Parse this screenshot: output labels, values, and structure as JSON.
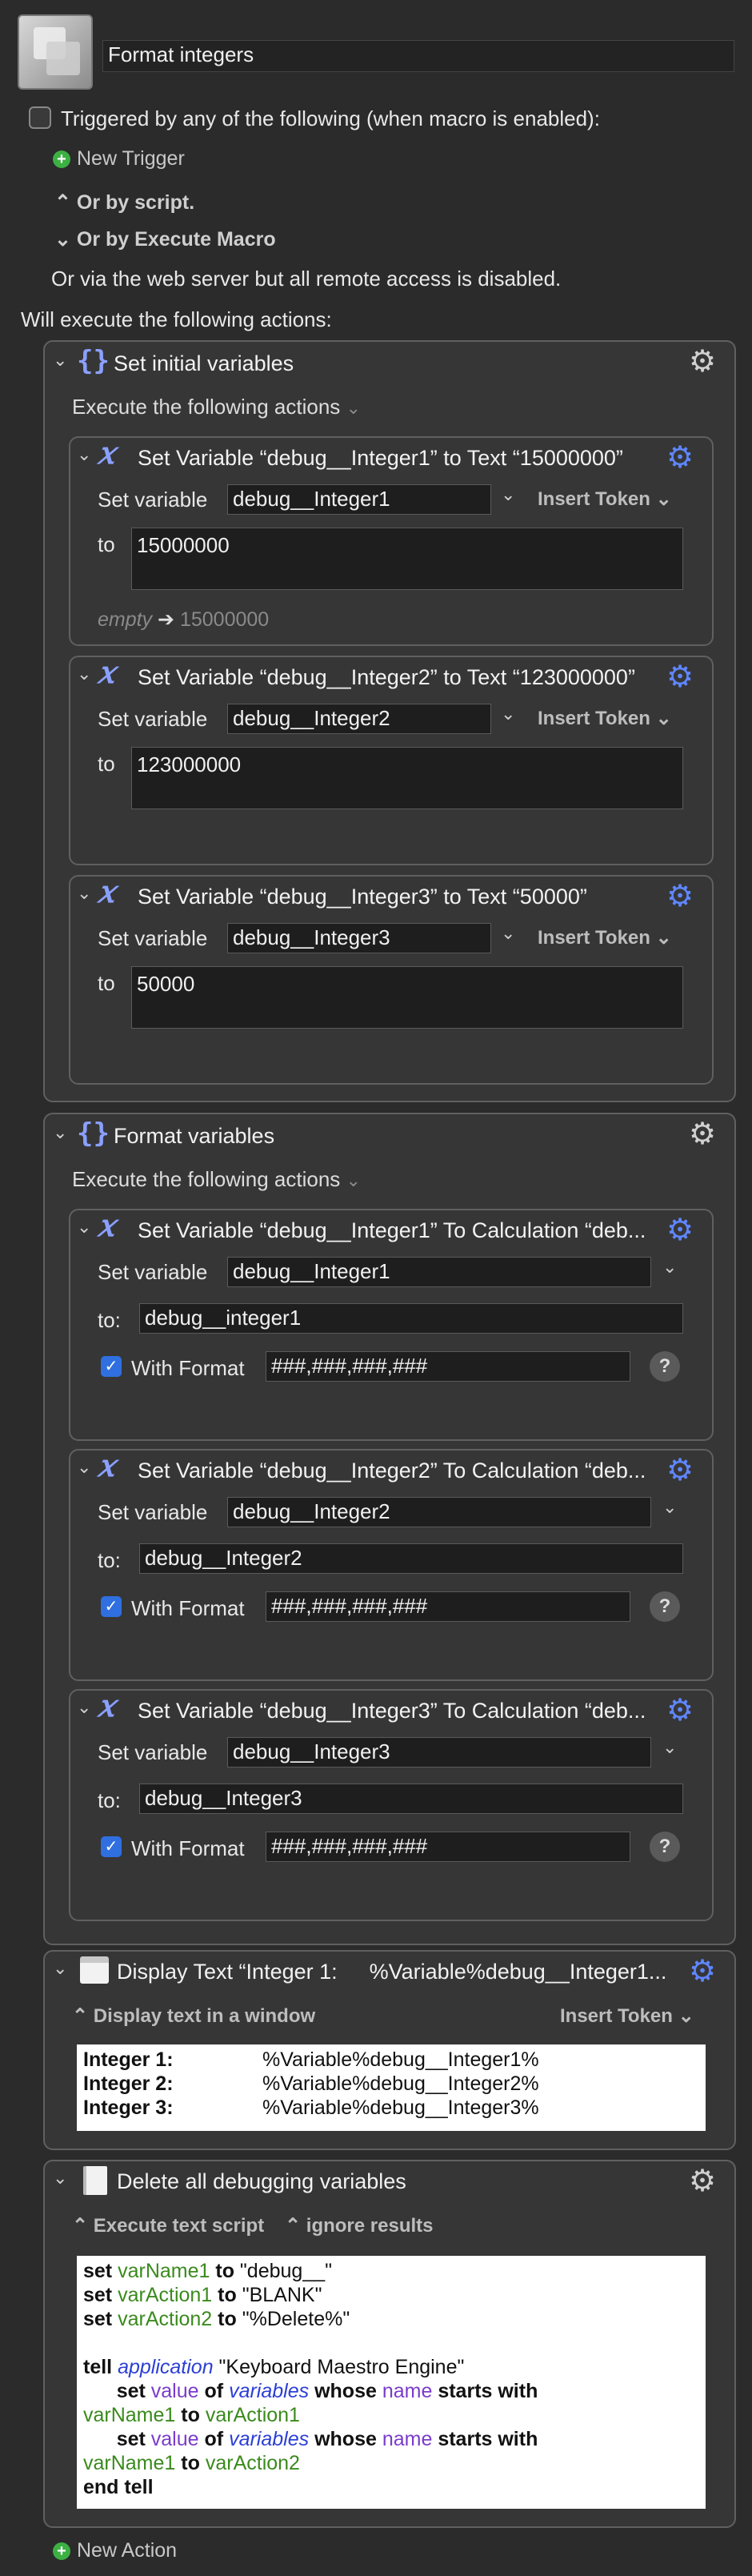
{
  "macro": {
    "name": "Format integers",
    "trigger_label": "Triggered by any of the following (when macro is enabled):",
    "new_trigger": "New Trigger",
    "or_by_script": "Or by script.",
    "or_by_execute": "Or by Execute Macro",
    "web_server": "Or via the web server but all remote access is disabled.",
    "will_execute": "Will execute the following actions:"
  },
  "group1": {
    "title": "Set initial variables",
    "execute_label": "Execute the following actions",
    "actions": [
      {
        "title": "Set Variable “debug__Integer1” to Text “15000000”",
        "set_label": "Set variable",
        "var": "debug__Integer1",
        "insert": "Insert Token",
        "to_label": "to",
        "value": "15000000",
        "preview_empty": "empty",
        "preview_arrow": "➔",
        "preview_val": "15000000"
      },
      {
        "title": "Set Variable “debug__Integer2” to Text “123000000”",
        "set_label": "Set variable",
        "var": "debug__Integer2",
        "insert": "Insert Token",
        "to_label": "to",
        "value": "123000000"
      },
      {
        "title": "Set Variable “debug__Integer3” to Text “50000”",
        "set_label": "Set variable",
        "var": "debug__Integer3",
        "insert": "Insert Token",
        "to_label": "to",
        "value": "50000"
      }
    ]
  },
  "group2": {
    "title": "Format variables",
    "execute_label": "Execute the following actions",
    "actions": [
      {
        "title": "Set Variable “debug__Integer1” To Calculation “deb...",
        "set_label": "Set variable",
        "var": "debug__Integer1",
        "to_label": "to:",
        "calc": "debug__integer1",
        "format_label": "With Format",
        "format": "###,###,###,###",
        "help": "?"
      },
      {
        "title": "Set Variable “debug__Integer2” To Calculation “deb...",
        "set_label": "Set variable",
        "var": "debug__Integer2",
        "to_label": "to:",
        "calc": "debug__Integer2",
        "format_label": "With Format",
        "format": "###,###,###,###",
        "help": "?"
      },
      {
        "title": "Set Variable “debug__Integer3” To Calculation “deb...",
        "set_label": "Set variable",
        "var": "debug__Integer3",
        "to_label": "to:",
        "calc": "debug__Integer3",
        "format_label": "With Format",
        "format": "###,###,###,###",
        "help": "?"
      }
    ]
  },
  "display": {
    "title": "Display Text “Integer 1:",
    "title_tail": "%Variable%debug__Integer1...",
    "mode": "Display text in a window",
    "insert": "Insert Token",
    "rows": [
      {
        "label": "Integer 1:",
        "value": "%Variable%debug__Integer1%"
      },
      {
        "label": "Integer 2:",
        "value": "%Variable%debug__Integer2%"
      },
      {
        "label": "Integer 3:",
        "value": "%Variable%debug__Integer3%"
      }
    ]
  },
  "delete": {
    "title": "Delete all debugging variables",
    "mode": "Execute text script",
    "results": "ignore results"
  },
  "footer": {
    "new_action": "New Action"
  },
  "colors": {
    "accent": "#5f86ff",
    "check": "#2f6fe0",
    "green": "#3b8a1e"
  }
}
